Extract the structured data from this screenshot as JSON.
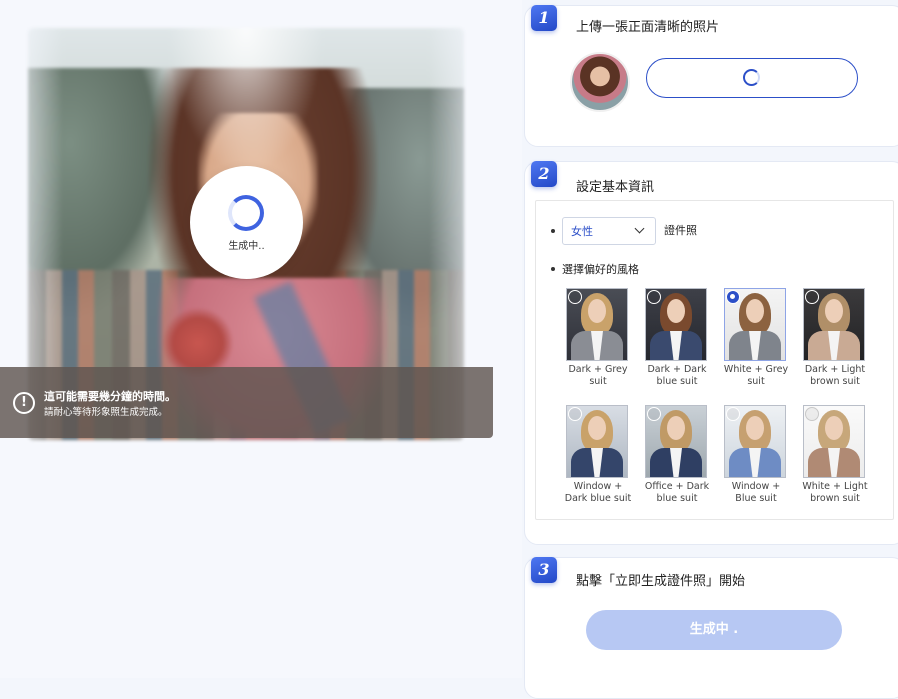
{
  "preview": {
    "loading_text": "生成中..",
    "notice_title": "這可能需要幾分鐘的時間。",
    "notice_subtitle": "請耐心等待形象照生成完成。"
  },
  "step1": {
    "number": "1",
    "title": "上傳一張正面清晰的照片"
  },
  "step2": {
    "number": "2",
    "title": "設定基本資訊",
    "gender_value": "女性",
    "gender_suffix": "證件照",
    "style_label": "選擇偏好的風格",
    "styles": [
      {
        "line1": "Dark + Grey",
        "line2": "suit",
        "selected": false
      },
      {
        "line1": "Dark + Dark",
        "line2": "blue suit",
        "selected": false
      },
      {
        "line1": "White + Grey",
        "line2": "suit",
        "selected": true
      },
      {
        "line1": "Dark + Light",
        "line2": "brown suit",
        "selected": false
      },
      {
        "line1": "Window +",
        "line2": "Dark blue suit",
        "selected": false
      },
      {
        "line1": "Office + Dark",
        "line2": "blue suit",
        "selected": false
      },
      {
        "line1": "Window +",
        "line2": "Blue suit",
        "selected": false
      },
      {
        "line1": "White + Light",
        "line2": "brown suit",
        "selected": false
      }
    ]
  },
  "step3": {
    "number": "3",
    "title": "點擊「立即生成證件照」開始",
    "button_label": "生成中 ."
  },
  "colors": {
    "accent": "#2c4fc8",
    "button_disabled": "#b7c8f3"
  }
}
